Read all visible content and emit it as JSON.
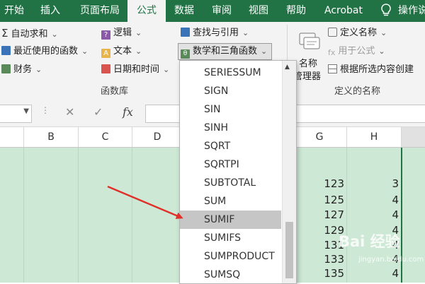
{
  "tabs": [
    {
      "label": "开始"
    },
    {
      "label": "插入"
    },
    {
      "label": "页面布局"
    },
    {
      "label": "公式"
    },
    {
      "label": "数据"
    },
    {
      "label": "审阅"
    },
    {
      "label": "视图"
    },
    {
      "label": "帮助"
    },
    {
      "label": "Acrobat"
    },
    {
      "label": "操作说"
    }
  ],
  "active_tab": "公式",
  "ribbon": {
    "autosum": "自动求和",
    "recent": "最近使用的函数",
    "finance": "财务",
    "logic": "逻辑",
    "text": "文本",
    "datetime": "日期和时间",
    "lookup": "查找与引用",
    "math": "数学和三角函数",
    "library_label": "函数库",
    "name_manager_line1": "名称",
    "name_manager_line2": "管理器",
    "define_name": "定义名称",
    "use_in_formula": "用于公式",
    "create_from_selection": "根据所选内容创建",
    "defined_names_label": "定义的名称"
  },
  "formula_bar": {
    "cancel": "✕",
    "enter": "✓",
    "fx": "fx"
  },
  "columns": [
    "B",
    "C",
    "D",
    "G",
    "H"
  ],
  "cells": {
    "G": [
      123,
      125,
      127,
      129,
      131,
      133,
      135
    ],
    "H": [
      3,
      4,
      4,
      4,
      4,
      4,
      4
    ]
  },
  "dropdown": {
    "items": [
      "SERIESSUM",
      "SIGN",
      "SIN",
      "SINH",
      "SQRT",
      "SQRTPI",
      "SUBTOTAL",
      "SUM",
      "SUMIF",
      "SUMIFS",
      "SUMPRODUCT",
      "SUMSQ"
    ],
    "highlighted": "SUMIF"
  },
  "watermark": {
    "text": "Bai 经验",
    "sub": "jingyan.baidu.com"
  },
  "colors": {
    "excel_green": "#217346",
    "sheet_selection": "#cde8d5",
    "arrow": "#e0302a"
  }
}
